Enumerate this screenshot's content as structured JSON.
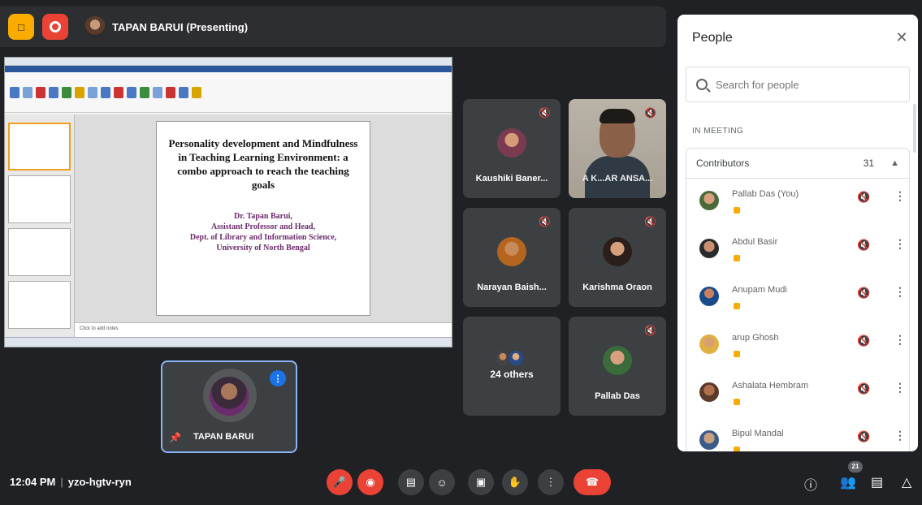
{
  "topbar": {
    "presenter_label": "TAPAN BARUI (Presenting)"
  },
  "slide": {
    "title": "Personality development and Mindfulness in Teaching Learning Environment: a combo approach to reach the teaching goals",
    "author": "Dr. Tapan Barui,",
    "role": "Assistant Professor and Head,",
    "dept": "Dept. of Library and Information Science,",
    "university": "University of North Bengal",
    "notes_placeholder": "Click to add notes"
  },
  "tiles": [
    {
      "name": "Kaushiki Baner..."
    },
    {
      "name": "A K...AR ANSA..."
    },
    {
      "name": "Narayan Baish..."
    },
    {
      "name": "Karishma Oraon"
    },
    {
      "name": "24 others"
    },
    {
      "name": "Pallab Das"
    }
  ],
  "self_tile": {
    "name": "TAPAN BARUI"
  },
  "people": {
    "title": "People",
    "search_placeholder": "Search for people",
    "section": "IN MEETING",
    "group_label": "Contributors",
    "group_count": "31",
    "participants": [
      {
        "name": "Pallab Das (You)"
      },
      {
        "name": "Abdul Basir"
      },
      {
        "name": "Anupam Mudi"
      },
      {
        "name": "arup Ghosh"
      },
      {
        "name": "Ashalata Hembram"
      },
      {
        "name": "Bipul Mandal"
      }
    ]
  },
  "bottom": {
    "time": "12:04 PM",
    "meeting_code": "yzo-hgtv-ryn",
    "participant_count": "21"
  },
  "colors": {
    "background": "#202124",
    "tile": "#3c4043",
    "danger": "#ea4335",
    "accent": "#1a73e8",
    "highlight": "#f9ab00"
  },
  "icons": [
    "logo-icon",
    "record-icon",
    "mic-off-icon",
    "camera-off-icon",
    "captions-icon",
    "emoji-icon",
    "present-icon",
    "raise-hand-icon",
    "more-icon",
    "end-call-icon",
    "info-icon",
    "people-icon",
    "chat-icon",
    "activities-icon",
    "search-icon",
    "close-icon",
    "chevron-up-icon",
    "pin-icon",
    "speaking-icon"
  ]
}
